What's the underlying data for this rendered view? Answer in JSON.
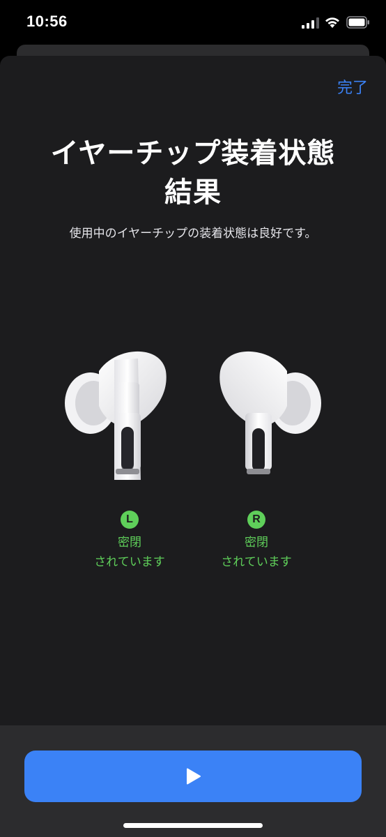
{
  "status_bar": {
    "time": "10:56"
  },
  "header": {
    "done_label": "完了"
  },
  "main": {
    "title_line1": "イヤーチップ装着状態",
    "title_line2": "結果",
    "subtitle": "使用中のイヤーチップの装着状態は良好です。"
  },
  "earbuds": [
    {
      "side": "L",
      "status_line1": "密閉",
      "status_line2": "されています"
    },
    {
      "side": "R",
      "status_line1": "密閉",
      "status_line2": "されています"
    }
  ],
  "colors": {
    "accent": "#3b82f6",
    "success": "#5fcf5a",
    "sheet_bg": "#1c1c1e"
  },
  "icons": {
    "play": "play-icon",
    "signal": "signal-icon",
    "wifi": "wifi-icon",
    "battery": "battery-icon"
  }
}
